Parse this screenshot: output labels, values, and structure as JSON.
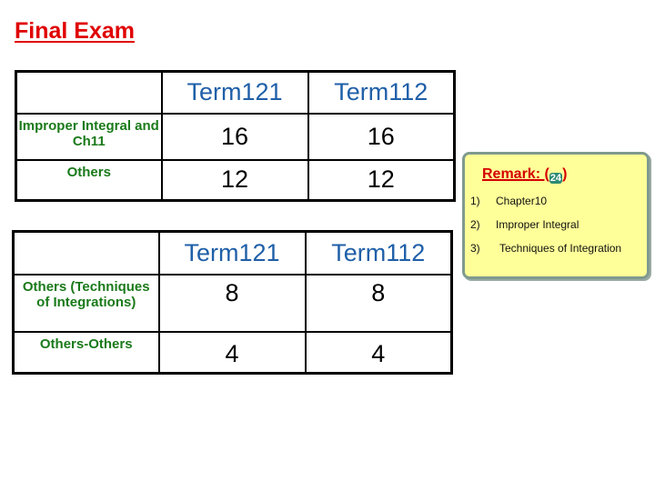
{
  "title": "Final Exam",
  "tables": [
    {
      "headers": [
        "",
        "Term121",
        "Term112"
      ],
      "rows": [
        {
          "label": "Improper Integral and Ch11",
          "values": [
            "16",
            "16"
          ]
        },
        {
          "label": "Others",
          "values": [
            "12",
            "12"
          ]
        }
      ]
    },
    {
      "headers": [
        "",
        "Term121",
        "Term112"
      ],
      "rows": [
        {
          "label": "Others (Techniques of Integrations)",
          "values": [
            "8",
            "8"
          ]
        },
        {
          "label": "Others-Others",
          "values": [
            "4",
            "4"
          ]
        }
      ]
    }
  ],
  "remark": {
    "title_prefix": "Remark: (",
    "badge": "24",
    "title_suffix": ")",
    "items": [
      {
        "num": "1)",
        "text": "Chapter10"
      },
      {
        "num": "2)",
        "text": "Improper Integral"
      },
      {
        "num": "3)",
        "text": "Techniques of Integration"
      }
    ]
  },
  "colors": {
    "title": "#e00000",
    "header_text": "#1f5fa8",
    "row_label": "#1a7a1a",
    "remark_bg": "#ffff99",
    "remark_title": "#d40000",
    "badge_bg": "#2e8b73"
  }
}
